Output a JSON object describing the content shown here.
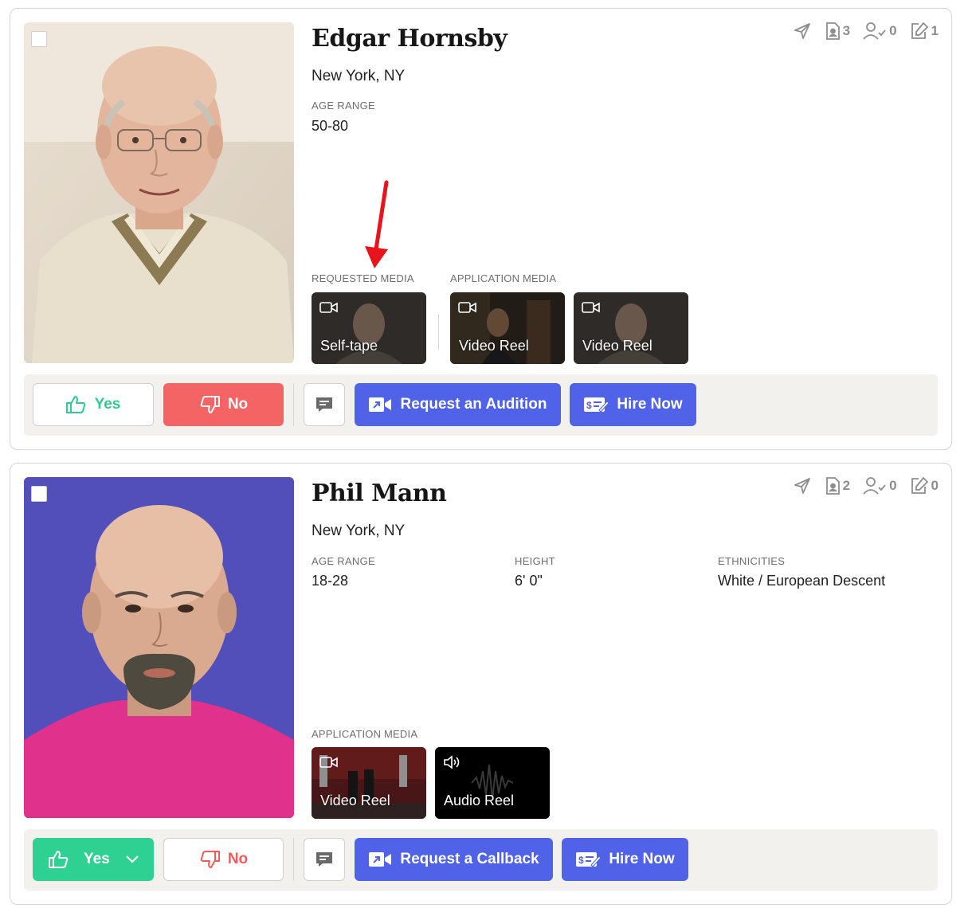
{
  "cards": [
    {
      "name": "Edgar Hornsby",
      "location": "New York, NY",
      "attributes": [
        {
          "label": "AGE RANGE",
          "value": "50-80"
        }
      ],
      "stats": {
        "sent": "",
        "submissions": "3",
        "checked": "0",
        "notes": "1"
      },
      "media_groups": [
        {
          "label": "REQUESTED MEDIA",
          "items": [
            {
              "type": "video",
              "label": "Self-tape"
            }
          ]
        },
        {
          "label": "APPLICATION MEDIA",
          "items": [
            {
              "type": "video",
              "label": "Video Reel"
            },
            {
              "type": "video",
              "label": "Video Reel"
            }
          ]
        }
      ],
      "actions": {
        "yes_label": "Yes",
        "no_label": "No",
        "primary_label": "Request an Audition",
        "hire_label": "Hire Now"
      }
    },
    {
      "name": "Phil Mann",
      "location": "New York, NY",
      "attributes": [
        {
          "label": "AGE RANGE",
          "value": "18-28"
        },
        {
          "label": "HEIGHT",
          "value": "6' 0\""
        },
        {
          "label": "ETHNICITIES",
          "value": "White / European Descent"
        }
      ],
      "stats": {
        "sent": "",
        "submissions": "2",
        "checked": "0",
        "notes": "0"
      },
      "media_groups": [
        {
          "label": "APPLICATION MEDIA",
          "items": [
            {
              "type": "video",
              "label": "Video Reel"
            },
            {
              "type": "audio",
              "label": "Audio Reel"
            }
          ]
        }
      ],
      "actions": {
        "yes_label": "Yes",
        "no_label": "No",
        "primary_label": "Request a Callback",
        "hire_label": "Hire Now"
      }
    }
  ],
  "colors": {
    "accent_blue": "#4f62e8",
    "yes_green": "#2fd193",
    "no_red": "#f46464",
    "annotation_arrow": "#e8141b"
  },
  "icons": [
    "send-icon",
    "submission-icon",
    "user-check-icon",
    "edit-icon",
    "video-camera-icon",
    "speaker-icon",
    "thumbs-up-icon",
    "thumbs-down-icon",
    "comment-icon",
    "video-request-icon",
    "hire-icon",
    "chevron-down-icon"
  ]
}
